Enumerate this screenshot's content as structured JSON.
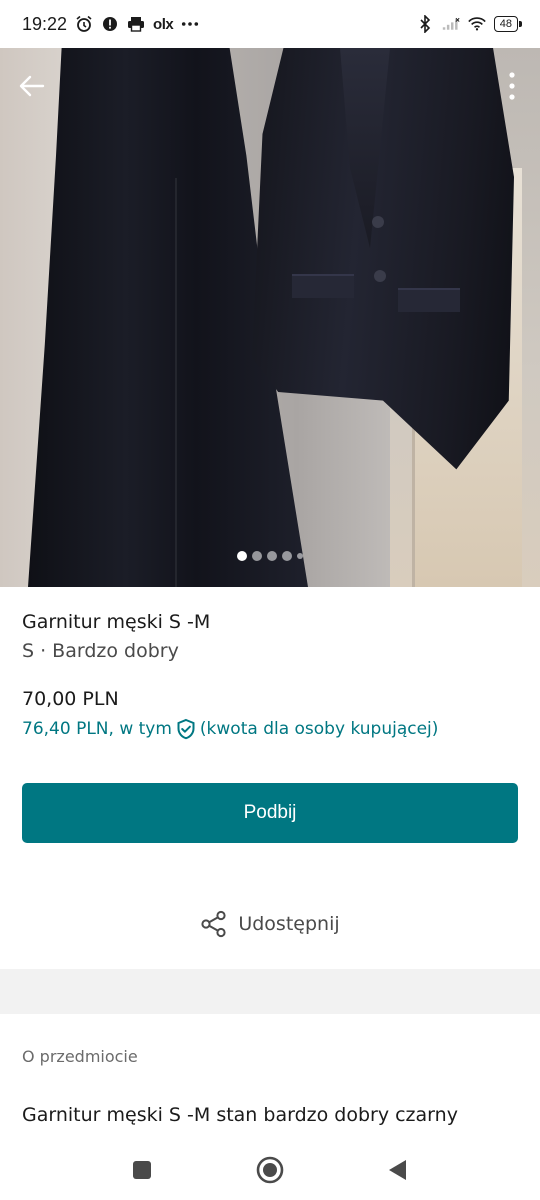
{
  "status_bar": {
    "time": "19:22",
    "olx_label": "olx",
    "battery": "48",
    "icons": [
      "alarm-icon",
      "alert-icon",
      "printer-icon",
      "more-dots-icon",
      "bluetooth-icon",
      "signal-icon",
      "wifi-icon"
    ]
  },
  "gallery": {
    "image_count": 5,
    "active_index": 0
  },
  "item": {
    "title": "Garnitur męski S -M",
    "subtitle": "S · Bardzo dobry",
    "price": "70,00 PLN",
    "buyer_price_prefix": "76,40 PLN, w tym",
    "buyer_price_suffix": "(kwota dla osoby kupującej)"
  },
  "actions": {
    "bump_label": "Podbij",
    "share_label": "Udostępnij"
  },
  "about": {
    "section_label": "O przedmiocie",
    "description": "Garnitur męski S -M stan bardzo dobry czarny"
  },
  "colors": {
    "accent": "#007782",
    "divider_band": "#f2f2f2"
  }
}
